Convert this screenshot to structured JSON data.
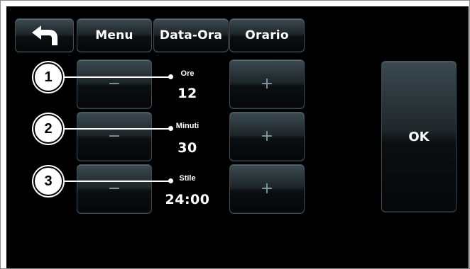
{
  "toolbar": {
    "back_icon": "back-arrow-icon",
    "tabs": [
      {
        "label": "Menu"
      },
      {
        "label": "Data-Ora"
      },
      {
        "label": "Orario"
      }
    ]
  },
  "fields": [
    {
      "label": "Ore",
      "value": "12",
      "minus": "−",
      "plus": "+"
    },
    {
      "label": "Minuti",
      "value": "30",
      "minus": "−",
      "plus": "+"
    },
    {
      "label": "Stile",
      "value": "24:00",
      "minus": "−",
      "plus": "+"
    }
  ],
  "ok_label": "OK",
  "callouts": [
    "1",
    "2",
    "3"
  ],
  "colors": {
    "screen_background": "#000000",
    "button_border": "#3a4f58",
    "sign_color": "#7f9aa4"
  }
}
